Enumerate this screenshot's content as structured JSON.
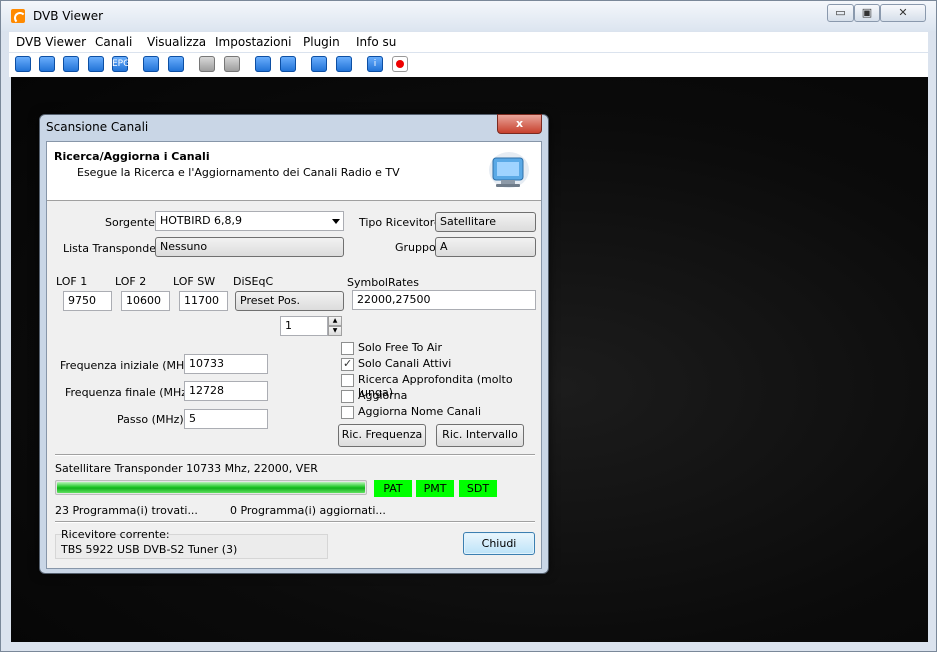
{
  "app": {
    "title": "DVB Viewer"
  },
  "caption": {
    "minimize": "▭",
    "restore": "▣",
    "close": "✕"
  },
  "menu": [
    "DVB Viewer",
    "Canali",
    "Visualizza",
    "Impostazioni",
    "Plugin",
    "Info su"
  ],
  "toolbar": {
    "icons": [
      "window-icon",
      "fullscreen-icon",
      "picture-icon",
      "list-icon",
      "epg-icon",
      "channel-prev-icon",
      "channel-next-icon",
      "audio-prev-icon",
      "audio-next-icon",
      "back-icon",
      "forward-icon",
      "playlist-icon",
      "settings-icon",
      "info-icon",
      "record-icon"
    ],
    "epg_text": "EPG",
    "info_text": "i"
  },
  "dialog": {
    "title": "Scansione Canali",
    "close": "x",
    "header_title": "Ricerca/Aggiorna i Canali",
    "header_subtitle": "Esegue la Ricerca e l'Aggiornamento dei Canali Radio e TV",
    "sorgente_label": "Sorgente",
    "sorgente_value": "HOTBIRD 6,8,9",
    "tipo_label": "Tipo Ricevitore",
    "tipo_value": "Satellitare",
    "lista_label": "Lista Transponder",
    "lista_value": "Nessuno",
    "gruppo_label": "Gruppo",
    "gruppo_value": "A",
    "lof1_label": "LOF 1",
    "lof1_value": "9750",
    "lof2_label": "LOF 2",
    "lof2_value": "10600",
    "lofsw_label": "LOF SW",
    "lofsw_value": "11700",
    "diseqc_label": "DiSEqC",
    "diseqc_value": "Preset Pos.",
    "symbolrates_label": "SymbolRates",
    "symbolrates_value": "22000,27500",
    "spin_value": "1",
    "freq_start_label": "Frequenza iniziale (MHz)",
    "freq_start_value": "10733",
    "freq_end_label": "Frequenza finale (MHz)",
    "freq_end_value": "12728",
    "step_label": "Passo (MHz)",
    "step_value": "5",
    "checkboxes": [
      {
        "label": "Solo Free To Air",
        "checked": false
      },
      {
        "label": "Solo Canali Attivi",
        "checked": true
      },
      {
        "label": "Ricerca Approfondita (molto lunga)",
        "checked": false
      },
      {
        "label": "Aggiorna",
        "checked": false
      },
      {
        "label": "Aggiorna Nome Canali",
        "checked": false
      }
    ],
    "btn_freq": "Ric. Frequenza",
    "btn_interval": "Ric. Intervallo",
    "status_text": "Satellitare Transponder 10733 Mhz, 22000, VER",
    "progress": 1.0,
    "badge_pat": "PAT",
    "badge_pmt": "PMT",
    "badge_sdt": "SDT",
    "found_text": "23 Programma(i) trovati...",
    "updated_text": "0 Programma(i) aggiornati...",
    "receiver_label": "Ricevitore corrente:",
    "receiver_value": "TBS 5922 USB DVB-S2 Tuner (3)",
    "close_button": "Chiudi"
  },
  "colors": {
    "badge": "#00ff00",
    "progress": "#22c92a",
    "accent": "#3c7fb1"
  }
}
